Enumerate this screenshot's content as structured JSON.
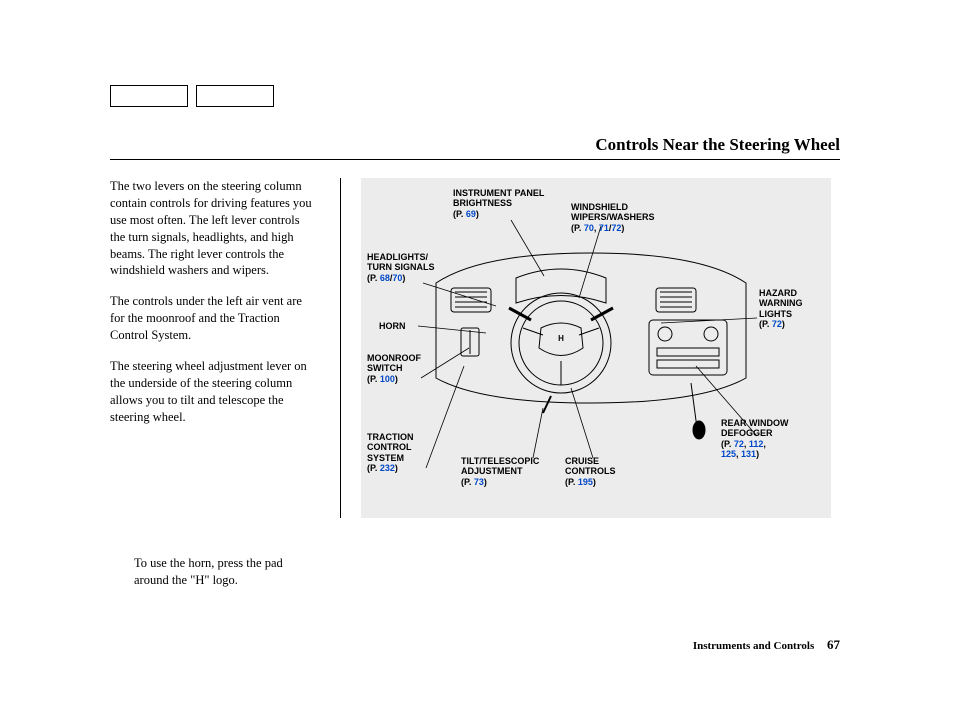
{
  "title": "Controls Near the Steering Wheel",
  "paragraphs": {
    "p1": "The two levers on the steering column contain controls for driving features you use most often. The left lever controls the turn signals, headlights, and high beams. The right lever controls the windshield washers and wipers.",
    "p2": "The controls under the left air vent are for the moonroof and the Traction Control System.",
    "p3": "The steering wheel adjustment lever on the underside of the steering column allows you to tilt and telescope the steering wheel.",
    "horn": "To use the horn, press the pad around the \"H\" logo."
  },
  "callouts": {
    "instrument_panel": {
      "l1": "INSTRUMENT PANEL",
      "l2": "BRIGHTNESS",
      "p": "(P. ",
      "n": "69",
      "close": ")"
    },
    "windshield": {
      "l1": "WINDSHIELD",
      "l2": "WIPERS/WASHERS",
      "p": "(P. ",
      "n1": "70",
      "sep1": ", ",
      "n2": "71",
      "sep2": "/",
      "n3": "72",
      "close": ")"
    },
    "headlights": {
      "l1": "HEADLIGHTS/",
      "l2": "TURN SIGNALS",
      "p": "(P. ",
      "n1": "68",
      "sep": "/",
      "n2": "70",
      "close": ")"
    },
    "horn": {
      "l1": "HORN"
    },
    "moonroof": {
      "l1": "MOONROOF",
      "l2": "SWITCH",
      "p": "(P. ",
      "n": "100",
      "close": ")"
    },
    "traction": {
      "l1": "TRACTION",
      "l2": "CONTROL",
      "l3": "SYSTEM",
      "p": "(P. ",
      "n": "232",
      "close": ")"
    },
    "tilt": {
      "l1": "TILT/TELESCOPIC",
      "l2": "ADJUSTMENT",
      "p": "(P. ",
      "n": "73",
      "close": ")"
    },
    "cruise": {
      "l1": "CRUISE",
      "l2": "CONTROLS",
      "p": "(P. ",
      "n": "195",
      "close": ")"
    },
    "hazard": {
      "l1": "HAZARD",
      "l2": "WARNING",
      "l3": "LIGHTS",
      "p": "(P. ",
      "n": "72",
      "close": ")"
    },
    "rear": {
      "l1": "REAR WINDOW",
      "l2": "DEFOGGER",
      "p": "(P. ",
      "n1": "72",
      "sep1": ", ",
      "n2": "112",
      "sep2": ",",
      "l3a": "125",
      "sep3": ", ",
      "l3b": "131",
      "close": ")"
    }
  },
  "footer": {
    "section": "Instruments and Controls",
    "page": "67"
  }
}
